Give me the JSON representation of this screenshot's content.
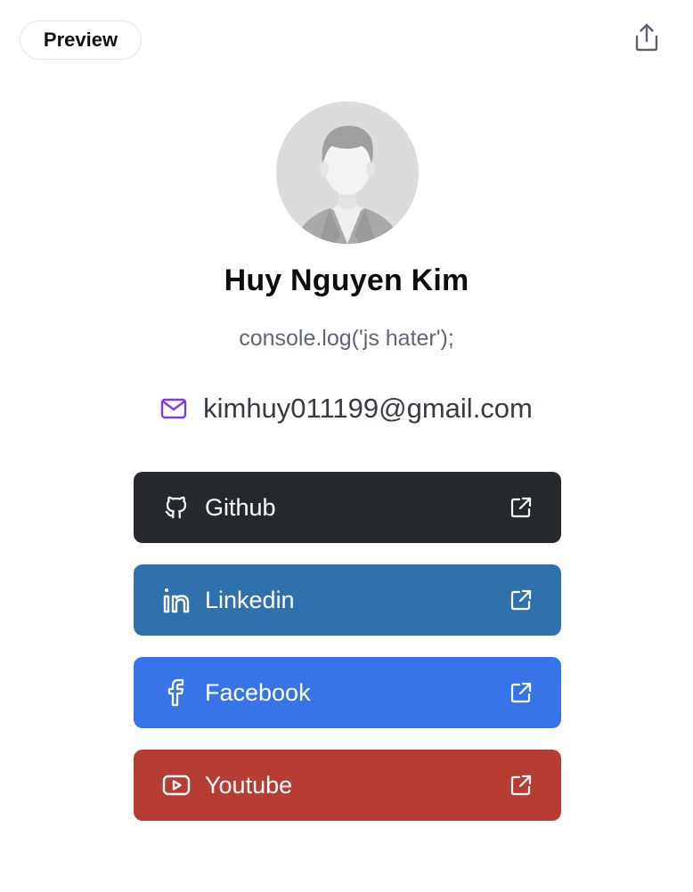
{
  "header": {
    "preview_label": "Preview",
    "share_icon": "share-icon"
  },
  "profile": {
    "avatar_icon": "default-person-avatar",
    "name": "Huy Nguyen Kim",
    "bio": "console.log('js hater');",
    "email": "kimhuy011199@gmail.com",
    "email_icon": "mail-icon"
  },
  "links": [
    {
      "label": "Github",
      "icon": "github-icon",
      "color": "#25282c"
    },
    {
      "label": "Linkedin",
      "icon": "linkedin-icon",
      "color": "#2f71ad"
    },
    {
      "label": "Facebook",
      "icon": "facebook-icon",
      "color": "#3674e8"
    },
    {
      "label": "Youtube",
      "icon": "youtube-icon",
      "color": "#b73c34"
    }
  ],
  "colors": {
    "mail_accent": "#7c3aed",
    "border": "#e2e4e8",
    "bio_text": "#5f6673"
  }
}
